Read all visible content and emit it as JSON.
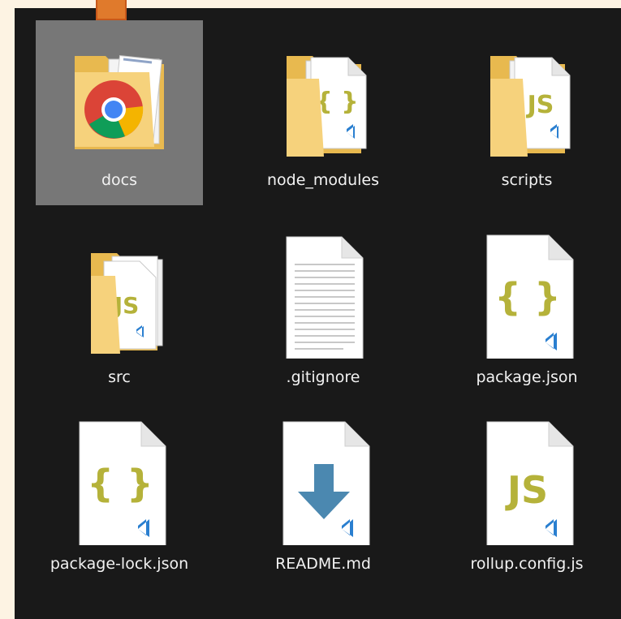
{
  "window": {
    "background": "#191919",
    "selection_color": "#777777",
    "accent": "#e07a2c"
  },
  "files": [
    {
      "name": "docs",
      "kind": "folder",
      "icon": "chrome-folder-icon",
      "selected": true
    },
    {
      "name": "node_modules",
      "kind": "folder",
      "icon": "json-folder-icon",
      "selected": false
    },
    {
      "name": "scripts",
      "kind": "folder",
      "icon": "js-folder-icon",
      "selected": false
    },
    {
      "name": "src",
      "kind": "folder",
      "icon": "js-folder-icon",
      "selected": false
    },
    {
      "name": ".gitignore",
      "kind": "file",
      "icon": "text-file-icon",
      "selected": false
    },
    {
      "name": "package.json",
      "kind": "file",
      "icon": "json-file-icon",
      "selected": false
    },
    {
      "name": "package-lock.json",
      "kind": "file",
      "icon": "json-file-icon",
      "selected": false
    },
    {
      "name": "README.md",
      "kind": "file",
      "icon": "markdown-file-icon",
      "selected": false
    },
    {
      "name": "rollup.config.js",
      "kind": "file",
      "icon": "js-file-icon",
      "selected": false
    }
  ],
  "icon_glyphs": {
    "json": "{ }",
    "js": "JS"
  }
}
